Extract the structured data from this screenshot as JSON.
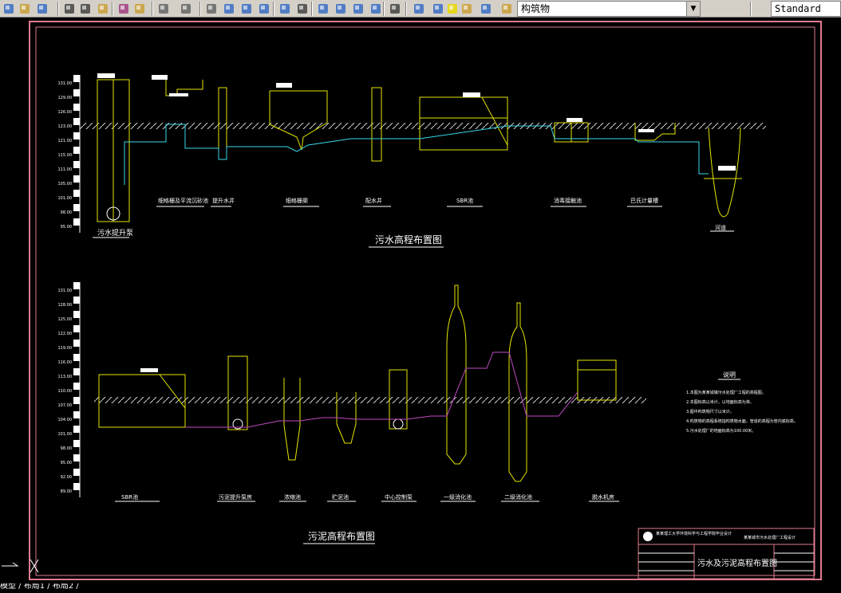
{
  "toolbar": {
    "layer_name": "构筑物",
    "text_style": "Standard",
    "icons": [
      "new-icon",
      "open-icon",
      "save-icon",
      "cut-icon",
      "copy-icon",
      "paste-icon",
      "match-properties-icon",
      "undo-icon",
      "redo-icon",
      "pan-icon",
      "zoom-realtime-icon",
      "zoom-window-icon",
      "zoom-previous-icon",
      "properties-icon",
      "design-center-icon",
      "tool-palettes-icon",
      "sheet-set-icon",
      "markup-icon",
      "calculator-icon",
      "help-icon",
      "layer-manager-icon",
      "bulb-icon",
      "sun-icon",
      "lock-icon",
      "color-swatch-icon",
      "make-current-icon",
      "layer-previous-icon",
      "text-style-icon"
    ]
  },
  "drawing": {
    "top_title": "污水高程布置图",
    "bottom_title": "污泥高程布置图",
    "sewage_units": [
      "污水提升泵",
      "细格栅及平流沉砂池",
      "提升水井",
      "细格栅渠",
      "配水井",
      "SBR池",
      "消毒接触池",
      "巴氏计量槽",
      "河道"
    ],
    "sludge_units": [
      "SBR池",
      "污泥提升泵房",
      "浓缩池",
      "贮泥池",
      "中心控制泵",
      "一级消化池",
      "二级消化池",
      "脱水机房"
    ],
    "notes_title": "说明",
    "notes": [
      "1.本图为某某城镇污水处理厂工程的高程图。",
      "2.本图标高以米计，以地面标高为准。",
      "3.图中构筑物尺寸以米计。",
      "4.构筑物的高程系统指构筑物水面，管道的高程为管内底标高。",
      "5.污水处理厂的地面标高为100.00米。"
    ],
    "axis_top_labels": [
      "131.00",
      "129.00",
      "126.00",
      "123.00",
      "121.00",
      "115.00",
      "111.00",
      "105.00",
      "101.00",
      "98.00",
      "95.00"
    ],
    "axis_bottom_labels": [
      "131.00",
      "128.00",
      "125.00",
      "122.00",
      "119.00",
      "116.00",
      "113.00",
      "110.00",
      "107.00",
      "104.00",
      "101.00",
      "98.00",
      "95.00",
      "92.00",
      "89.00"
    ],
    "title_block": {
      "school": "某某理工大学环境科学与工程学院毕业设计",
      "project": "某某城市污水处理厂工程设计",
      "drawing_name": "污水及污泥高程布置图"
    }
  },
  "status": {
    "tabs": "模型 / 布局1 / 布局2 /"
  }
}
